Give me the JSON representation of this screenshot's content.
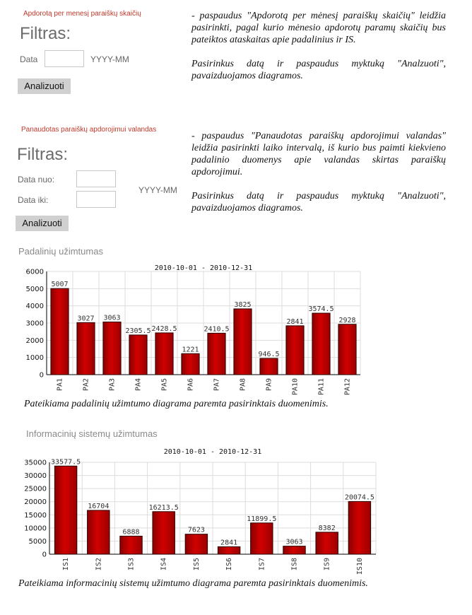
{
  "section1": {
    "title": "Apdorotą per menesį paraiškų skaičių",
    "filter_heading": "Filtras:",
    "data_label": "Data",
    "data_value": "",
    "format_hint": "YYYY-MM",
    "button_label": "Analizuoti",
    "desc_p1": "- paspaudus \"Apdorotą per mėnesį paraiškų skaičių\" leidžia pasirinkti, pagal kurio mėnesio apdorotų paramų skaičių bus pateiktos ataskaitas apie padalinius ir IS.",
    "desc_p2": "Pasirinkus datą ir paspaudus myktuką \"Analzuoti\", pavaizduojamos diagramos."
  },
  "section2": {
    "title": "Panaudotas paraiškų apdorojimui valandas",
    "filter_heading": "Filtras:",
    "from_label": "Data nuo:",
    "to_label": "Data iki:",
    "from_value": "",
    "to_value": "",
    "format_hint": "YYYY-MM",
    "button_label": "Analizuoti",
    "desc_p1": "- paspaudus \"Panaudotas paraiškų apdorojimui valandas\" leidžia pasirinkti laiko intervalą, iš kurio bus paimti kiekvieno padalinio duomenys apie valandas skirtas paraiškų apdorojimui.",
    "desc_p2": "Pasirinkus datą ir paspaudus myktuką \"Analzuoti\", pavaizduojamos diagramos."
  },
  "chart1_section": {
    "heading": "Padalinių užimtumas",
    "caption": "Pateikiama padalinių užimtumo diagrama paremta pasirinktais duomenimis."
  },
  "chart2_section": {
    "heading": "Informacinių sistemų užimtumas",
    "caption": "Pateikiama informacinių sistemų užimtumo diagrama paremta pasirinktais duomenimis."
  },
  "colors": {
    "bar_fill": "#d10000",
    "bar_stroke": "#2a0000",
    "grid": "#dddddd",
    "accent_red": "#c0392b"
  },
  "chart_data": [
    {
      "type": "bar",
      "title": "2010-10-01 - 2010-12-31",
      "categories": [
        "PA1",
        "PA2",
        "PA3",
        "PA4",
        "PA5",
        "PA6",
        "PA7",
        "PA8",
        "PA9",
        "PA10",
        "PA11",
        "PA12"
      ],
      "values": [
        5007,
        3027,
        3063,
        2305.5,
        2428.5,
        1221,
        2410.5,
        3825,
        946.5,
        2841,
        3574.5,
        2928
      ],
      "value_labels": [
        "5007",
        "3027",
        "3063",
        "2305.5",
        "2428.5",
        "1221",
        "2410.5",
        "3825",
        "946.5",
        "2841",
        "3574.5",
        "2928"
      ],
      "ylim": [
        0,
        6000
      ],
      "yticks": [
        "0",
        "1000",
        "2000",
        "3000",
        "4000",
        "5000",
        "6000"
      ],
      "grid": true
    },
    {
      "type": "bar",
      "title": "2010-10-01 - 2010-12-31",
      "categories": [
        "IS1",
        "IS2",
        "IS3",
        "IS4",
        "IS5",
        "IS6",
        "IS7",
        "IS8",
        "IS9",
        "IS10"
      ],
      "values": [
        33577.5,
        16704,
        6888,
        16213.5,
        7623,
        2841,
        11899.5,
        3063,
        8382,
        20074.5
      ],
      "value_labels": [
        "33577.5",
        "16704",
        "6888",
        "16213.5",
        "7623",
        "2841",
        "11899.5",
        "3063",
        "8382",
        "20074.5"
      ],
      "ylim": [
        0,
        35000
      ],
      "yticks": [
        "0",
        "5000",
        "10000",
        "15000",
        "20000",
        "25000",
        "30000",
        "35000"
      ],
      "grid": true
    }
  ]
}
